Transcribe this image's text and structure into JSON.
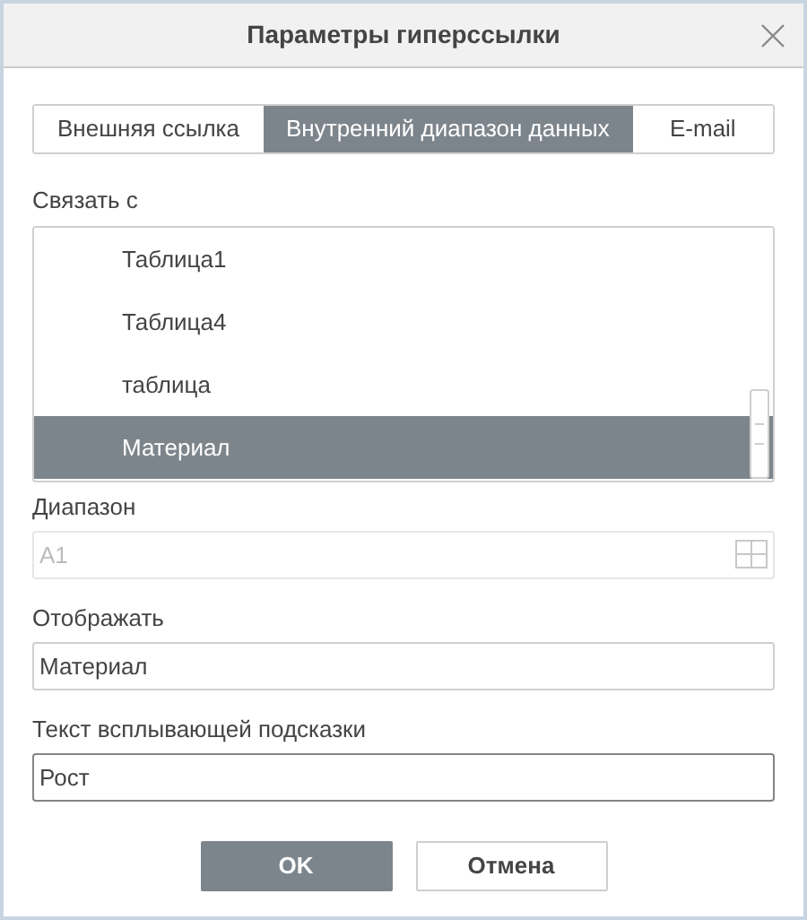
{
  "window": {
    "title": "Параметры гиперссылки"
  },
  "tabs": [
    {
      "label": "Внешняя ссылка",
      "selected": false
    },
    {
      "label": "Внутренний диапазон данных",
      "selected": true
    },
    {
      "label": "E-mail",
      "selected": false
    }
  ],
  "link_to": {
    "label": "Связать с",
    "items": [
      {
        "label": "Таблица1",
        "selected": false
      },
      {
        "label": "Таблица4",
        "selected": false
      },
      {
        "label": "таблица",
        "selected": false
      },
      {
        "label": "Материал",
        "selected": true
      }
    ]
  },
  "range": {
    "label": "Диапазон",
    "placeholder": "A1",
    "disabled": true
  },
  "display": {
    "label": "Отображать",
    "value": "Материал",
    "focused": false
  },
  "tooltip": {
    "label": "Текст всплывающей подсказки",
    "value": "Рост",
    "focused": true
  },
  "buttons": [
    {
      "label": "OK",
      "kind": "primary"
    },
    {
      "label": "Отмена",
      "kind": "secondary"
    }
  ]
}
